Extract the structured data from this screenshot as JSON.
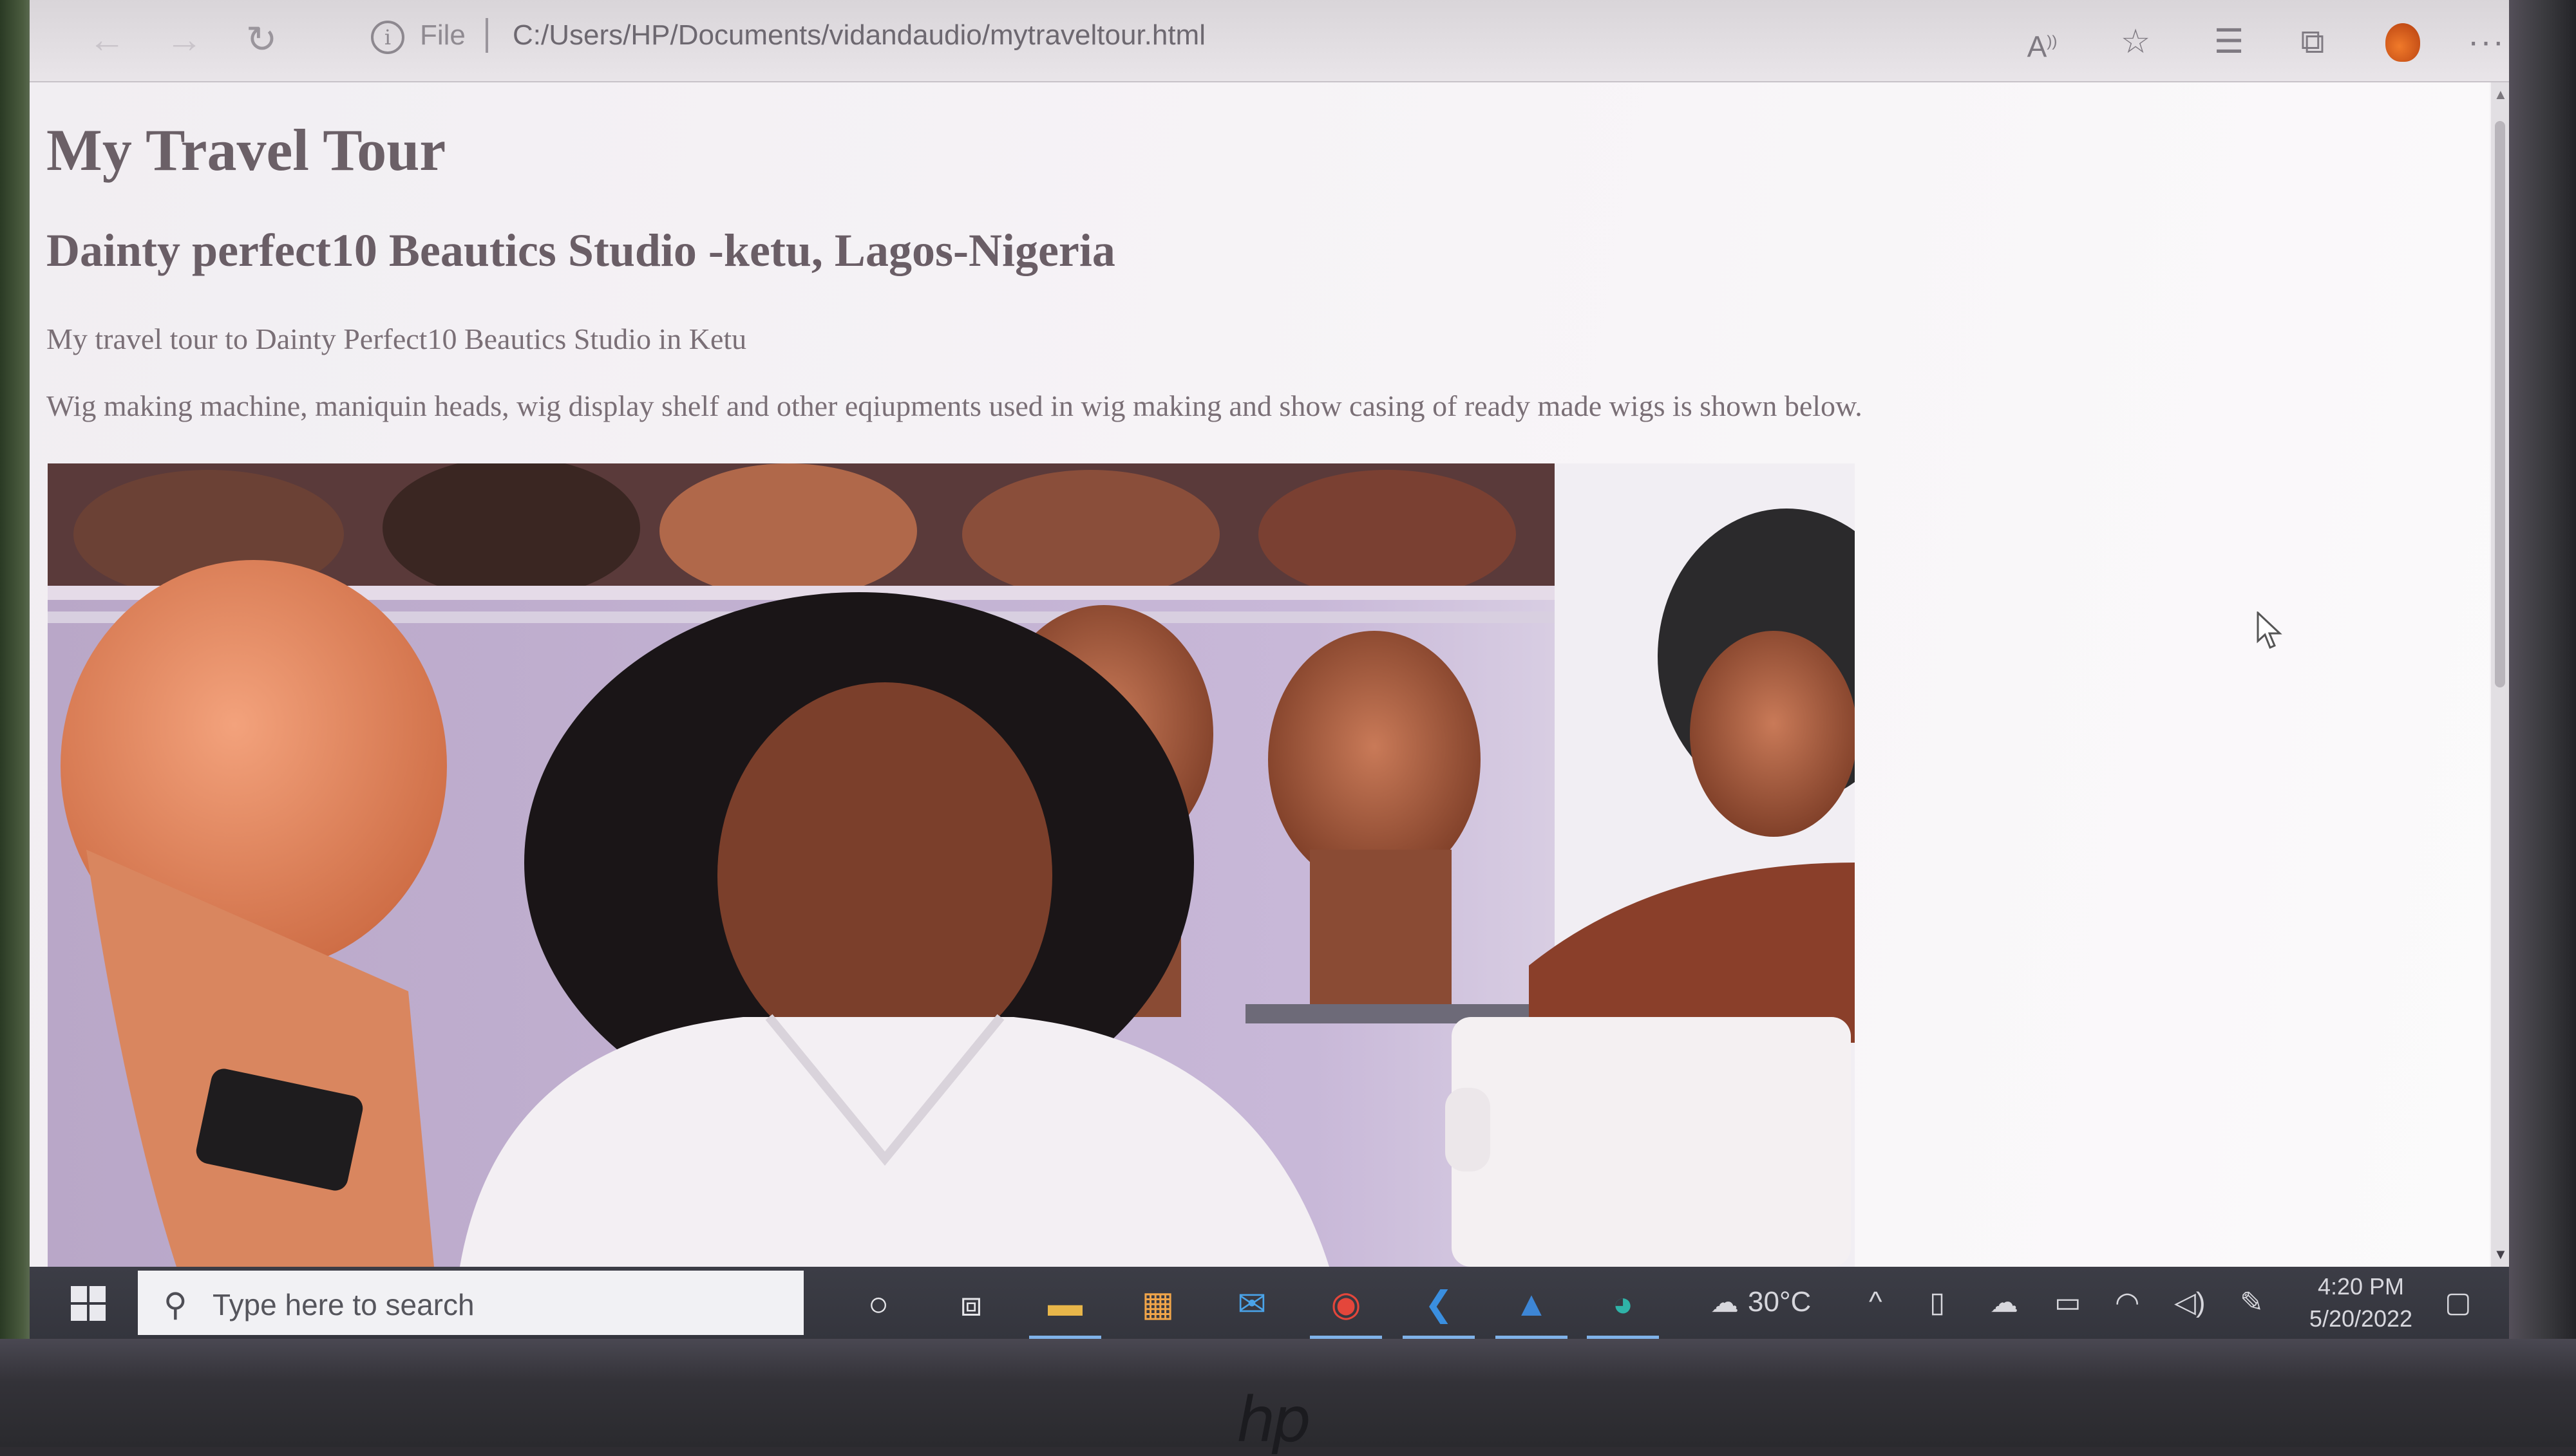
{
  "browser": {
    "address_bar": {
      "protocol_label": "File",
      "url": "C:/Users/HP/Documents/vidandaudio/mytraveltour.html"
    },
    "icons": [
      "back-icon",
      "forward-icon",
      "refresh-icon",
      "info-icon",
      "read-aloud-icon",
      "favorite-add-icon",
      "favorites-icon",
      "collections-icon",
      "profile-icon",
      "more-icon"
    ]
  },
  "page": {
    "title": "My Travel Tour",
    "subtitle": "Dainty perfect10 Beautics Studio -ketu, Lagos-Nigeria",
    "intro": "My travel tour to Dainty Perfect10 Beautics Studio in Ketu",
    "description": "Wig making machine, maniquin heads, wig display shelf and other eqiupments used in wig making and show casing of ready made wigs is shown below."
  },
  "taskbar": {
    "search_placeholder": "Type here to search",
    "apps": [
      "cortana-icon",
      "task-view-icon",
      "file-explorer-icon",
      "store-icon",
      "mail-icon",
      "chrome-icon",
      "vscode-icon",
      "photos-icon",
      "edge-icon"
    ],
    "weather": "30°C",
    "time": "4:20 PM",
    "date": "5/20/2022"
  },
  "colors": {
    "heading": "#6b6067",
    "taskbar": "#3c3d46",
    "accent_underline": "#7fb2e8"
  }
}
